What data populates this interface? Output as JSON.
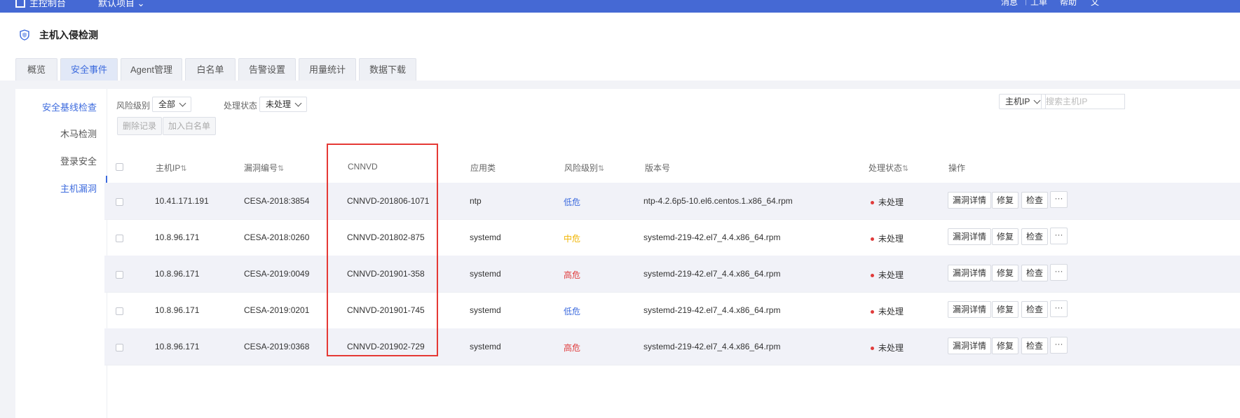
{
  "topbar": {
    "brand": "主控制台",
    "project": "默认项目",
    "right_items": [
      "消息",
      "工单",
      "帮助",
      "文"
    ]
  },
  "page": {
    "title": "主机入侵检测"
  },
  "tabs": [
    "概览",
    "安全事件",
    "Agent管理",
    "白名单",
    "告警设置",
    "用量统计",
    "数据下载"
  ],
  "active_tab": "安全事件",
  "sidenav": [
    "安全基线检查",
    "木马检测",
    "登录安全",
    "主机漏洞"
  ],
  "active_nav": "主机漏洞",
  "filters": {
    "risk_label": "风险级别",
    "risk_value": "全部",
    "status_label": "处理状态",
    "status_value": "未处理",
    "search_type": "主机IP",
    "search_placeholder": "搜索主机IP"
  },
  "buttons": {
    "delete": "删除记录",
    "whitelist": "加入白名单"
  },
  "columns": {
    "host_ip": "主机IP",
    "vuln_id": "漏洞编号",
    "cnnvd": "CNNVD",
    "app": "应用类",
    "risk": "风险级别",
    "version": "版本号",
    "status": "处理状态",
    "ops": "操作",
    "sort_icon": "⇅"
  },
  "row_actions": {
    "details": "漏洞详情",
    "fix": "修复",
    "check": "检查",
    "more": "···"
  },
  "rows": [
    {
      "ip": "10.41.171.191",
      "vuln": "CESA-2018:3854",
      "cnnvd": "CNNVD-201806-1071",
      "app": "ntp",
      "risk": "低危",
      "version": "ntp-4.2.6p5-10.el6.centos.1.x86_64.rpm",
      "status": "未处理"
    },
    {
      "ip": "10.8.96.171",
      "vuln": "CESA-2018:0260",
      "cnnvd": "CNNVD-201802-875",
      "app": "systemd",
      "risk": "中危",
      "version": "systemd-219-42.el7_4.4.x86_64.rpm",
      "status": "未处理"
    },
    {
      "ip": "10.8.96.171",
      "vuln": "CESA-2019:0049",
      "cnnvd": "CNNVD-201901-358",
      "app": "systemd",
      "risk": "高危",
      "version": "systemd-219-42.el7_4.4.x86_64.rpm",
      "status": "未处理"
    },
    {
      "ip": "10.8.96.171",
      "vuln": "CESA-2019:0201",
      "cnnvd": "CNNVD-201901-745",
      "app": "systemd",
      "risk": "低危",
      "version": "systemd-219-42.el7_4.4.x86_64.rpm",
      "status": "未处理"
    },
    {
      "ip": "10.8.96.171",
      "vuln": "CESA-2019:0368",
      "cnnvd": "CNNVD-201902-729",
      "app": "systemd",
      "risk": "高危",
      "version": "systemd-219-42.el7_4.4.x86_64.rpm",
      "status": "未处理"
    }
  ],
  "colors": {
    "accent": "#3d6bde",
    "topbar": "#4569d4",
    "danger": "#e03b3b",
    "warning": "#f0b400",
    "highlight_box": "#e53935"
  }
}
